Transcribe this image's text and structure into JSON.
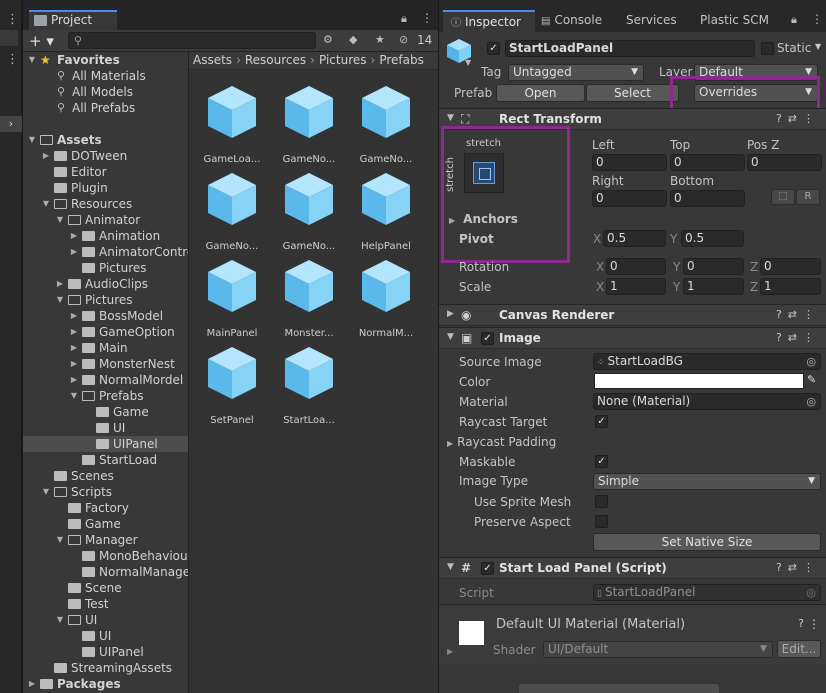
{
  "project": {
    "tab_label": "Project",
    "search_placeholder": "",
    "hidden_count": "14",
    "favorites": {
      "label": "Favorites",
      "items": [
        "All Materials",
        "All Models",
        "All Prefabs"
      ]
    },
    "tree": [
      {
        "label": "Assets",
        "depth": 0,
        "state": "open"
      },
      {
        "label": "DOTween",
        "depth": 1,
        "state": "closed"
      },
      {
        "label": "Editor",
        "depth": 1,
        "state": "none"
      },
      {
        "label": "Plugin",
        "depth": 1,
        "state": "none"
      },
      {
        "label": "Resources",
        "depth": 1,
        "state": "open"
      },
      {
        "label": "Animator",
        "depth": 2,
        "state": "open"
      },
      {
        "label": "Animation",
        "depth": 3,
        "state": "closed"
      },
      {
        "label": "AnimatorContro",
        "depth": 3,
        "state": "closed"
      },
      {
        "label": "Pictures",
        "depth": 3,
        "state": "none"
      },
      {
        "label": "AudioClips",
        "depth": 2,
        "state": "closed"
      },
      {
        "label": "Pictures",
        "depth": 2,
        "state": "open"
      },
      {
        "label": "BossModel",
        "depth": 3,
        "state": "closed"
      },
      {
        "label": "GameOption",
        "depth": 3,
        "state": "closed"
      },
      {
        "label": "Main",
        "depth": 3,
        "state": "closed"
      },
      {
        "label": "MonsterNest",
        "depth": 3,
        "state": "closed"
      },
      {
        "label": "NormalMordel",
        "depth": 3,
        "state": "closed"
      },
      {
        "label": "Prefabs",
        "depth": 3,
        "state": "open"
      },
      {
        "label": "Game",
        "depth": 4,
        "state": "none"
      },
      {
        "label": "UI",
        "depth": 4,
        "state": "none"
      },
      {
        "label": "UIPanel",
        "depth": 4,
        "state": "none",
        "selected": true
      },
      {
        "label": "StartLoad",
        "depth": 3,
        "state": "none"
      },
      {
        "label": "Scenes",
        "depth": 1,
        "state": "none"
      },
      {
        "label": "Scripts",
        "depth": 1,
        "state": "open"
      },
      {
        "label": "Factory",
        "depth": 2,
        "state": "none"
      },
      {
        "label": "Game",
        "depth": 2,
        "state": "none"
      },
      {
        "label": "Manager",
        "depth": 2,
        "state": "open"
      },
      {
        "label": "MonoBehaviour",
        "depth": 3,
        "state": "none"
      },
      {
        "label": "NormalManage",
        "depth": 3,
        "state": "none"
      },
      {
        "label": "Scene",
        "depth": 2,
        "state": "none"
      },
      {
        "label": "Test",
        "depth": 2,
        "state": "none"
      },
      {
        "label": "UI",
        "depth": 2,
        "state": "open"
      },
      {
        "label": "UI",
        "depth": 3,
        "state": "none"
      },
      {
        "label": "UIPanel",
        "depth": 3,
        "state": "none"
      },
      {
        "label": "StreamingAssets",
        "depth": 1,
        "state": "none"
      },
      {
        "label": "Packages",
        "depth": 0,
        "state": "closed"
      }
    ],
    "breadcrumb": [
      "Assets",
      "Resources",
      "Pictures",
      "Prefabs"
    ],
    "assets": [
      "GameLoa...",
      "GameNo...",
      "GameNo...",
      "GameNo...",
      "GameNo...",
      "HelpPanel",
      "MainPanel",
      "Monster...",
      "NormalM...",
      "SetPanel",
      "StartLoa..."
    ]
  },
  "inspector": {
    "tabs": [
      "Inspector",
      "Console",
      "Services",
      "Plastic SCM"
    ],
    "object_name": "StartLoadPanel",
    "static_label": "Static",
    "tag_label": "Tag",
    "tag_value": "Untagged",
    "layer_label": "Layer",
    "layer_value": "Default",
    "prefab_label": "Prefab",
    "open_label": "Open",
    "select_label": "Select",
    "overrides_label": "Overrides",
    "rect_transform": {
      "title": "Rect Transform",
      "stretch_h": "stretch",
      "stretch_v": "stretch",
      "left_label": "Left",
      "left": "0",
      "top_label": "Top",
      "top": "0",
      "posz_label": "Pos Z",
      "posz": "0",
      "right_label": "Right",
      "right": "0",
      "bottom_label": "Bottom",
      "bottom": "0",
      "raw_label": "R",
      "anchors_label": "Anchors",
      "pivot_label": "Pivot",
      "pivot_x": "0.5",
      "pivot_y": "0.5",
      "rotation_label": "Rotation",
      "rot_x": "0",
      "rot_y": "0",
      "rot_z": "0",
      "scale_label": "Scale",
      "scale_x": "1",
      "scale_y": "1",
      "scale_z": "1",
      "x": "X",
      "y": "Y",
      "z": "Z"
    },
    "canvas_renderer": {
      "title": "Canvas Renderer"
    },
    "image": {
      "title": "Image",
      "source_label": "Source Image",
      "source": "StartLoadBG",
      "color_label": "Color",
      "color": "#ffffff",
      "material_label": "Material",
      "material": "None (Material)",
      "raycast_target_label": "Raycast Target",
      "raycast_padding_label": "Raycast Padding",
      "maskable_label": "Maskable",
      "image_type_label": "Image Type",
      "image_type": "Simple",
      "use_sprite_mesh_label": "Use Sprite Mesh",
      "preserve_aspect_label": "Preserve Aspect",
      "set_native_size_label": "Set Native Size"
    },
    "script_comp": {
      "title": "Start Load Panel (Script)",
      "script_label": "Script",
      "script_value": "StartLoadPanel"
    },
    "material_comp": {
      "title": "Default UI Material (Material)",
      "shader_label": "Shader",
      "shader_value": "UI/Default",
      "edit_label": "Edit..."
    }
  },
  "colors": {
    "accent": "#4d8af0",
    "highlight": "#8d2a8f",
    "cube": "#7fd0f5"
  }
}
